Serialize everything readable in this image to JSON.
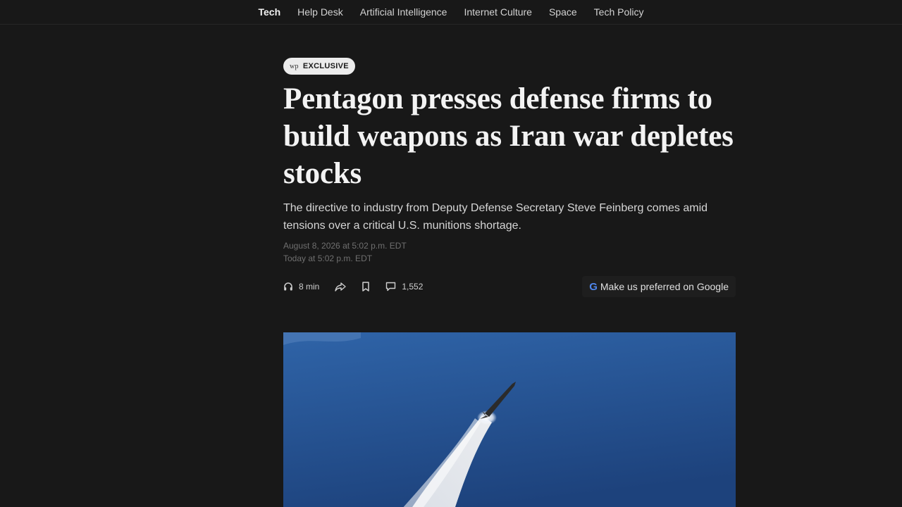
{
  "topnav": {
    "items": [
      {
        "label": "Tech",
        "active": true
      },
      {
        "label": "Help Desk"
      },
      {
        "label": "Artificial Intelligence"
      },
      {
        "label": "Internet Culture"
      },
      {
        "label": "Space"
      },
      {
        "label": "Tech Policy"
      }
    ]
  },
  "article": {
    "badge_mark": "wp",
    "badge_label": "EXCLUSIVE",
    "headline": "Pentagon presses defense firms to build weapons as Iran war depletes stocks",
    "dek": "The directive to industry from Deputy Defense Secretary Steve Feinberg comes amid tensions over a critical U.S. munitions shortage.",
    "published": "August 8, 2026 at 5:02 p.m. EDT",
    "updated": "Today at 5:02 p.m. EDT"
  },
  "toolbar": {
    "listen": "8 min",
    "comments": "1,552",
    "google_letter": "G",
    "google_label": "Make us preferred on Google"
  },
  "icons": {
    "listen": "headphones-icon",
    "share": "share-icon",
    "save": "bookmark-icon",
    "comments": "comment-icon"
  },
  "colors": {
    "background": "#181818",
    "badge_bg": "#ececec",
    "sky_top": "#2f5fa0",
    "sky_bottom": "#1c3f78"
  }
}
